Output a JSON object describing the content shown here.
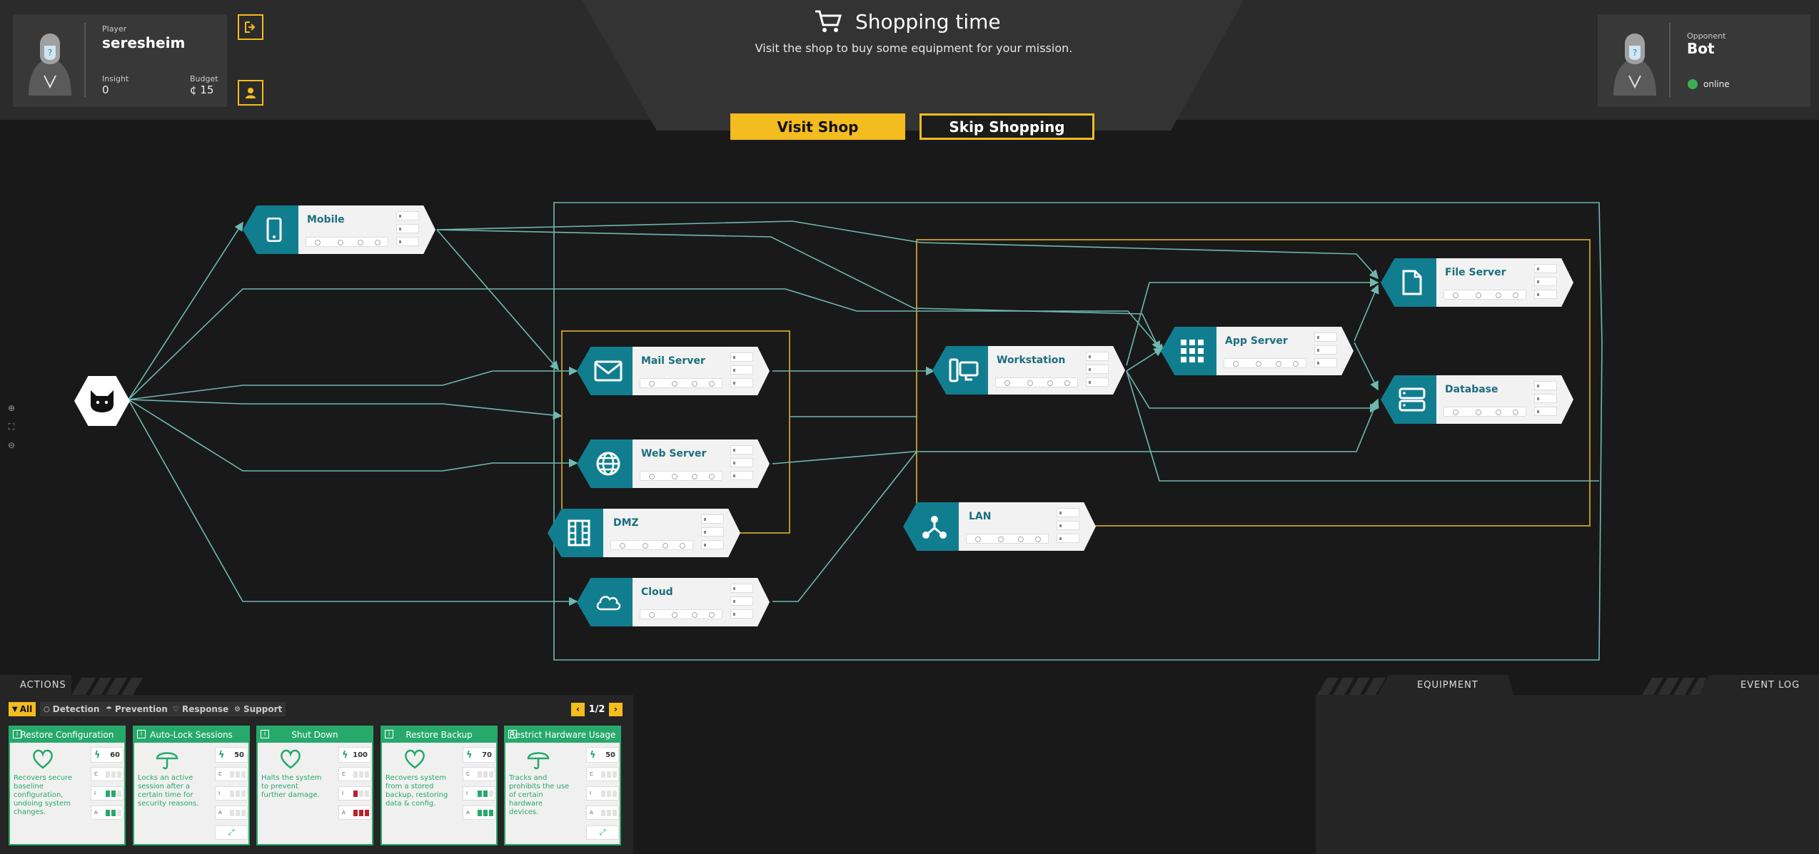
{
  "player": {
    "label": "Player",
    "name": "seresheim",
    "insight_label": "Insight",
    "insight_value": "0",
    "budget_label": "Budget",
    "budget_value": "¢ 15"
  },
  "opponent": {
    "label": "Opponent",
    "name": "Bot",
    "status": "online"
  },
  "phase": {
    "title": "Shopping time",
    "subtitle": "Visit the shop to buy some equipment for your mission.",
    "visit_label": "Visit Shop",
    "skip_label": "Skip Shopping"
  },
  "nodes": {
    "mobile": "Mobile",
    "mail": "Mail Server",
    "web": "Web Server",
    "dmz": "DMZ",
    "cloud": "Cloud",
    "workstation": "Workstation",
    "lan": "LAN",
    "app": "App Server",
    "file": "File Server",
    "database": "Database"
  },
  "actions": {
    "title": "ACTIONS",
    "filters": [
      "All",
      "Detection",
      "Prevention",
      "Response",
      "Support"
    ],
    "page": "1/2",
    "cards": [
      {
        "title": "Restore Configuration",
        "desc": "Recovers secure baseline configuration, undoing system changes.",
        "cost": "60",
        "icon": "heart-icon"
      },
      {
        "title": "Auto-Lock Sessions",
        "desc": "Locks an active session after a certain time for security reasons.",
        "cost": "50",
        "icon": "umbrella-icon"
      },
      {
        "title": "Shut Down",
        "desc": "Halts the system to prevent further damage.",
        "cost": "100",
        "icon": "heart-icon"
      },
      {
        "title": "Restore Backup",
        "desc": "Recovers system from a stored backup, restoring data & config.",
        "cost": "70",
        "icon": "heart-icon"
      },
      {
        "title": "Restrict Hardware Usage",
        "desc": "Tracks and prohibits the use of certain hardware devices.",
        "cost": "50",
        "icon": "umbrella-icon"
      }
    ],
    "stat_letters": [
      "C",
      "I",
      "A"
    ]
  },
  "panels": {
    "equipment": "EQUIPMENT",
    "event_log": "EVENT LOG"
  },
  "colors": {
    "accent": "#f3bc1f",
    "node": "#117e90",
    "card": "#27a96c",
    "edge": "#6fb8b0",
    "zone": "#b8922a"
  }
}
